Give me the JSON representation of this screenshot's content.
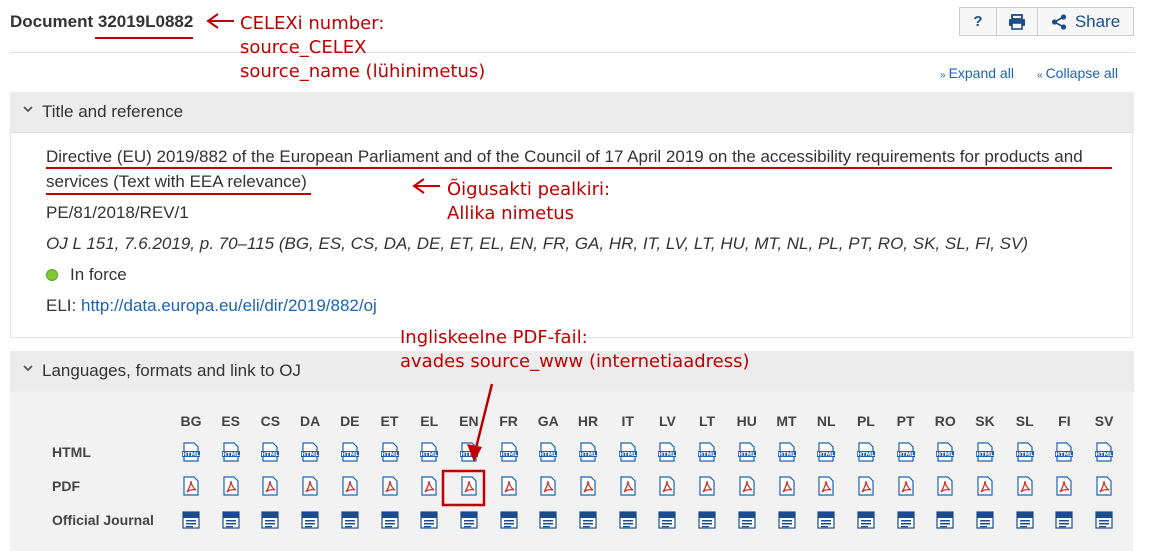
{
  "header": {
    "document_label": "Document",
    "celex": "32019L0882",
    "help_label": "?",
    "share_label": "Share",
    "expand_all": "Expand all",
    "collapse_all": "Collapse all"
  },
  "title_panel": {
    "heading": "Title and reference",
    "title": "Directive (EU) 2019/882 of the European Parliament and of the Council of 17 April 2019 on the accessibility requirements for products and services (Text with EEA relevance)",
    "code": "PE/81/2018/REV/1",
    "oj_reference": "OJ L 151, 7.6.2019, p. 70–115 (BG, ES, CS, DA, DE, ET, EL, EN, FR, GA, HR, IT, LV, LT, HU, MT, NL, PL, PT, RO, SK, SL, FI, SV)",
    "status": "In force",
    "eli_label": "ELI:",
    "eli_url": "http://data.europa.eu/eli/dir/2019/882/oj"
  },
  "languages_panel": {
    "heading": "Languages, formats and link to OJ",
    "languages": [
      "BG",
      "ES",
      "CS",
      "DA",
      "DE",
      "ET",
      "EL",
      "EN",
      "FR",
      "GA",
      "HR",
      "IT",
      "LV",
      "LT",
      "HU",
      "MT",
      "NL",
      "PL",
      "PT",
      "RO",
      "SK",
      "SL",
      "FI",
      "SV"
    ],
    "rows": [
      {
        "label": "HTML",
        "icon": "html-file-icon"
      },
      {
        "label": "PDF",
        "icon": "pdf-file-icon"
      },
      {
        "label": "Official Journal",
        "icon": "official-journal-icon"
      }
    ],
    "highlighted_language": "EN",
    "highlighted_row": "PDF"
  },
  "annotations": {
    "celex_note": [
      "CELEXi number:",
      "source_CELEX",
      "source_name (lühinimetus)"
    ],
    "title_note": [
      "Õigusakti pealkiri:",
      "Allika nimetus"
    ],
    "pdf_note": [
      "Ingliskeelne PDF-fail:",
      "avades source_www (internetiaadress)"
    ]
  },
  "colors": {
    "annotation": "#c00000",
    "link": "#1a63b4",
    "status_dot": "#7ec832",
    "panel_header": "#ececec"
  }
}
